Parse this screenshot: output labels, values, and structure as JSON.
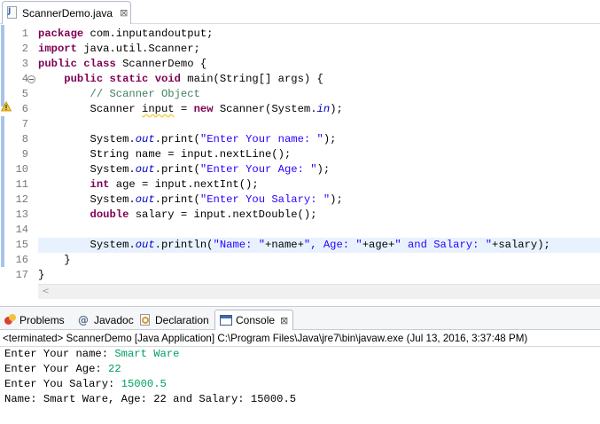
{
  "editor_tab": {
    "label": "ScannerDemo.java",
    "close": "⊠"
  },
  "code": {
    "line_numbers": [
      "1",
      "2",
      "3",
      "4",
      "5",
      "6",
      "7",
      "8",
      "9",
      "10",
      "11",
      "12",
      "13",
      "14",
      "15",
      "16",
      "17"
    ],
    "lines": [
      [
        {
          "t": "package",
          "c": "kw"
        },
        {
          "t": " com.inputandoutput;",
          "c": ""
        }
      ],
      [
        {
          "t": "import",
          "c": "kw"
        },
        {
          "t": " java.util.Scanner;",
          "c": ""
        }
      ],
      [
        {
          "t": "public",
          "c": "kw"
        },
        {
          "t": " ",
          "c": ""
        },
        {
          "t": "class",
          "c": "kw"
        },
        {
          "t": " ScannerDemo {",
          "c": ""
        }
      ],
      [
        {
          "t": "    ",
          "c": ""
        },
        {
          "t": "public",
          "c": "kw"
        },
        {
          "t": " ",
          "c": ""
        },
        {
          "t": "static",
          "c": "kw"
        },
        {
          "t": " ",
          "c": ""
        },
        {
          "t": "void",
          "c": "kw"
        },
        {
          "t": " main(String[] args) {",
          "c": ""
        }
      ],
      [
        {
          "t": "        ",
          "c": ""
        },
        {
          "t": "// Scanner Object",
          "c": "cm"
        }
      ],
      [
        {
          "t": "        Scanner ",
          "c": ""
        },
        {
          "t": "input",
          "c": "squiggle"
        },
        {
          "t": " = ",
          "c": ""
        },
        {
          "t": "new",
          "c": "kw"
        },
        {
          "t": " Scanner(System.",
          "c": ""
        },
        {
          "t": "in",
          "c": "static-fld"
        },
        {
          "t": ");",
          "c": ""
        }
      ],
      [],
      [
        {
          "t": "        System.",
          "c": ""
        },
        {
          "t": "out",
          "c": "static-fld"
        },
        {
          "t": ".print(",
          "c": ""
        },
        {
          "t": "\"Enter Your name: \"",
          "c": "st"
        },
        {
          "t": ");",
          "c": ""
        }
      ],
      [
        {
          "t": "        String name = input.nextLine();",
          "c": ""
        }
      ],
      [
        {
          "t": "        System.",
          "c": ""
        },
        {
          "t": "out",
          "c": "static-fld"
        },
        {
          "t": ".print(",
          "c": ""
        },
        {
          "t": "\"Enter Your Age: \"",
          "c": "st"
        },
        {
          "t": ");",
          "c": ""
        }
      ],
      [
        {
          "t": "        ",
          "c": ""
        },
        {
          "t": "int",
          "c": "kw"
        },
        {
          "t": " age = input.nextInt();",
          "c": ""
        }
      ],
      [
        {
          "t": "        System.",
          "c": ""
        },
        {
          "t": "out",
          "c": "static-fld"
        },
        {
          "t": ".print(",
          "c": ""
        },
        {
          "t": "\"Enter You Salary: \"",
          "c": "st"
        },
        {
          "t": ");",
          "c": ""
        }
      ],
      [
        {
          "t": "        ",
          "c": ""
        },
        {
          "t": "double",
          "c": "kw"
        },
        {
          "t": " salary = input.nextDouble();",
          "c": ""
        }
      ],
      [],
      [
        {
          "t": "        System.",
          "c": ""
        },
        {
          "t": "out",
          "c": "static-fld"
        },
        {
          "t": ".println(",
          "c": ""
        },
        {
          "t": "\"Name: \"",
          "c": "st"
        },
        {
          "t": "+name+",
          "c": ""
        },
        {
          "t": "\", Age: \"",
          "c": "st"
        },
        {
          "t": "+age+",
          "c": ""
        },
        {
          "t": "\" and Salary: \"",
          "c": "st"
        },
        {
          "t": "+salary);",
          "c": ""
        }
      ],
      [
        {
          "t": "    }",
          "c": ""
        }
      ],
      [
        {
          "t": "}",
          "c": ""
        }
      ]
    ],
    "current_line": 15,
    "scroll_left_arrow": "<"
  },
  "views": {
    "problems": "Problems",
    "javadoc": "Javadoc",
    "declaration": "Declaration",
    "console": "Console",
    "close": "⊠"
  },
  "console": {
    "header": "<terminated> ScannerDemo [Java Application] C:\\Program Files\\Java\\jre7\\bin\\javaw.exe (Jul 13, 2016, 3:37:48 PM)",
    "lines": [
      {
        "prompt": "Enter Your name: ",
        "input": "Smart Ware"
      },
      {
        "prompt": "Enter Your Age: ",
        "input": "22"
      },
      {
        "prompt": "Enter You Salary: ",
        "input": "15000.5"
      },
      {
        "prompt": "Name: Smart Ware, Age: 22 and Salary: 15000.5",
        "input": ""
      }
    ]
  }
}
